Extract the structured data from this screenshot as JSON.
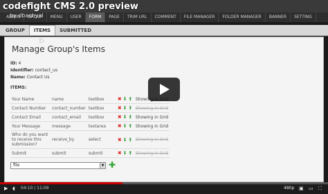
{
  "video": {
    "title": "codefight CMS 2.0 preview",
    "author": "by dbashyal",
    "time": "04:10 / 11:09",
    "quality": "480p",
    "progress": 0.374
  },
  "navbar": {
    "items": [
      "ADMIN",
      "GROUP",
      "MENU",
      "USER",
      "FORM",
      "PAGE",
      "TRIM URL",
      "COMMENT",
      "FILE MANAGER",
      "FOLDER MANAGER",
      "BANNER",
      "SETTING"
    ],
    "active_index": 4
  },
  "tabs": {
    "items": [
      "GROUP",
      "ITEMS",
      "SUBMITTED"
    ],
    "active_index": 1
  },
  "page": {
    "title": "Manage Group's Items",
    "id_label": "ID:",
    "id_value": "4",
    "identifier_label": "Identifier:",
    "identifier_value": "contact_us",
    "name_label": "Name:",
    "name_value": "Contact Us",
    "items_label": "ITEMS:"
  },
  "items": [
    {
      "label": "Your Name",
      "name": "name",
      "type": "textbox",
      "grid": "Showing in Grid",
      "shown": true
    },
    {
      "label": "Contact Number",
      "name": "contact_number",
      "type": "textbox",
      "grid": "Showing in Grid",
      "shown": false
    },
    {
      "label": "Contact Email",
      "name": "contact_email",
      "type": "textbox",
      "grid": "Showing in Grid",
      "shown": true
    },
    {
      "label": "Your Message",
      "name": "message",
      "type": "textarea",
      "grid": "Showing in Grid",
      "shown": true
    },
    {
      "label": "Who do you want to receive this submission?",
      "name": "receive_by",
      "type": "select",
      "grid": "Showing in Grid",
      "shown": false
    },
    {
      "label": "Submit",
      "name": "submit",
      "type": "submit",
      "grid": "Showing in Grid",
      "shown": false
    }
  ],
  "new_field": {
    "selected": "file"
  }
}
